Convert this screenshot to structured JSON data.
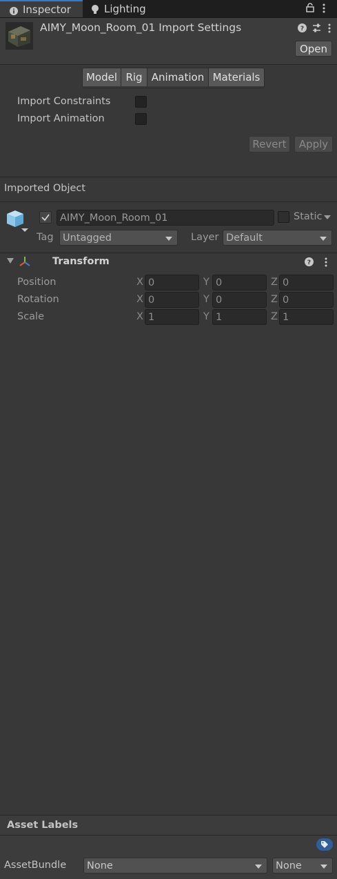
{
  "tabs": [
    {
      "label": "Inspector",
      "icon": "info-icon"
    },
    {
      "label": "Lighting",
      "icon": "lightbulb-icon"
    }
  ],
  "header": {
    "title": "AIMY_Moon_Room_01 Import Settings",
    "open_label": "Open"
  },
  "import_tabs": [
    "Model",
    "Rig",
    "Animation",
    "Materials"
  ],
  "active_import_tab": "Animation",
  "animation": {
    "import_constraints_label": "Import Constraints",
    "import_animation_label": "Import Animation",
    "revert_label": "Revert",
    "apply_label": "Apply"
  },
  "imported_object": {
    "section_title": "Imported Object",
    "name": "AIMY_Moon_Room_01",
    "static_label": "Static",
    "tag_label": "Tag",
    "tag_value": "Untagged",
    "layer_label": "Layer",
    "layer_value": "Default"
  },
  "transform": {
    "title": "Transform",
    "rows": [
      {
        "label": "Position",
        "x": "0",
        "y": "0",
        "z": "0"
      },
      {
        "label": "Rotation",
        "x": "0",
        "y": "0",
        "z": "0"
      },
      {
        "label": "Scale",
        "x": "1",
        "y": "1",
        "z": "1"
      }
    ],
    "axis_x": "X",
    "axis_y": "Y",
    "axis_z": "Z"
  },
  "footer": {
    "asset_labels_title": "Asset Labels",
    "assetbundle_label": "AssetBundle",
    "bundle_value": "None",
    "variant_value": "None"
  },
  "colors": {
    "background": "#383838",
    "accent": "#3a79bb",
    "label_icon": "#2e5f9c"
  }
}
